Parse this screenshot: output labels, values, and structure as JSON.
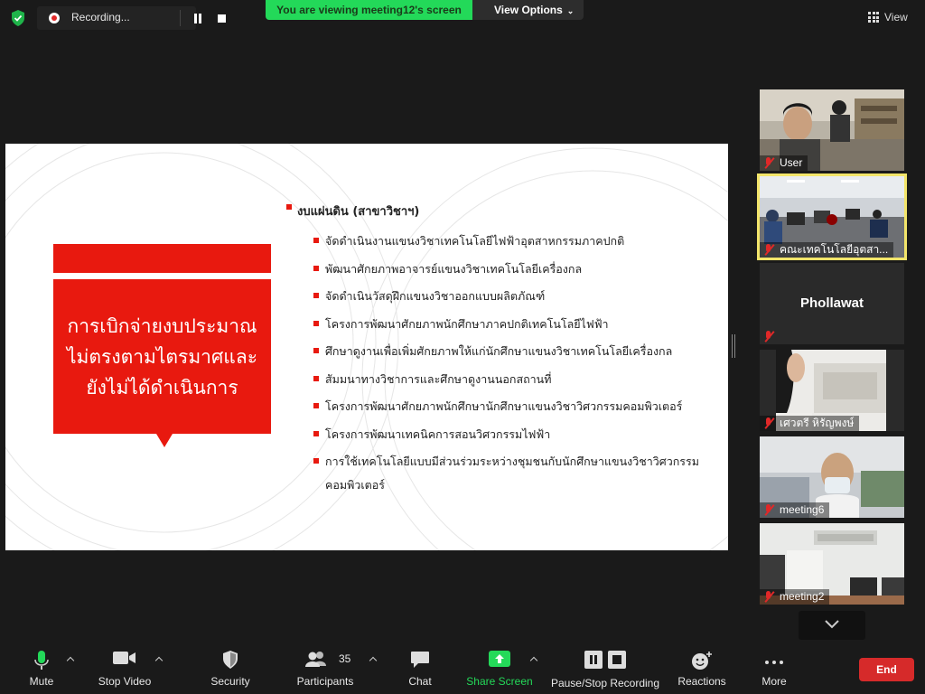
{
  "recording": {
    "label": "Recording..."
  },
  "banner": {
    "viewing": "You are viewing meeting12's screen",
    "view_options": "View Options"
  },
  "top_right": {
    "view_label": "View"
  },
  "slide": {
    "box_text_line1": "การเบิกจ่ายงบประมาณ",
    "box_text_line2": "ไม่ตรงตามไตรมาศและ",
    "box_text_line3": "ยังไม่ได้ดำเนินการ",
    "heading": "งบแผ่นดิน (สาขาวิชาฯ)",
    "items": [
      "จัดดำเนินงานแขนงวิชาเทคโนโลยีไฟฟ้าอุตสาหกรรมภาคปกติ",
      "พัฒนาศักยภาพอาจารย์แขนงวิชาเทคโนโลยีเครื่องกล",
      "จัดดำเนินวัสดุฝึกแขนงวิชาออกแบบผลิตภัณฑ์",
      "โครงการพัฒนาศักยภาพนักศึกษาภาคปกติเทคโนโลยีไฟฟ้า",
      "ศึกษาดูงานเพื่อเพิ่มศักยภาพให้แก่นักศึกษาแขนงวิชาเทคโนโลยีเครื่องกล",
      "สัมมนาทางวิชาการและศึกษาดูงานนอกสถานที่",
      "โครงการพัฒนาศักยภาพนักศึกษานักศึกษาแขนงวิชาวิศวกรรมคอมพิวเตอร์",
      "โครงการพัฒนาเทคนิคการสอนวิศวกรรมไฟฟ้า",
      "การใช้เทคโนโลยีแบบมีส่วนร่วมระหว่างชุมชนกับนักศึกษาแขนงวิชาวิศวกรรม คอมพิวเตอร์"
    ]
  },
  "gallery": [
    {
      "name": "User",
      "muted": true,
      "video": "photo-man-headphones"
    },
    {
      "name": "คณะเทคโนโลยีอุตสา...",
      "muted": true,
      "video": "photo-computer-lab",
      "active": true
    },
    {
      "name": "Phollawat",
      "muted": true,
      "video": "none"
    },
    {
      "name": "เศวตรี หิรัญพงษ์",
      "muted": true,
      "video": "photo-woman-office"
    },
    {
      "name": "meeting6",
      "muted": true,
      "video": "photo-man-mask"
    },
    {
      "name": "meeting2",
      "muted": true,
      "video": "photo-empty-room"
    }
  ],
  "toolbar": {
    "mute": "Mute",
    "stop_video": "Stop Video",
    "security": "Security",
    "participants": "Participants",
    "participants_count": "35",
    "chat": "Chat",
    "share_screen": "Share Screen",
    "pause_stop_recording": "Pause/Stop Recording",
    "reactions": "Reactions",
    "more": "More",
    "end": "End"
  },
  "colors": {
    "share_green": "#24d959",
    "end_red": "#d62a2a",
    "slide_red": "#e8190f",
    "active_tile": "#f3e56a"
  }
}
